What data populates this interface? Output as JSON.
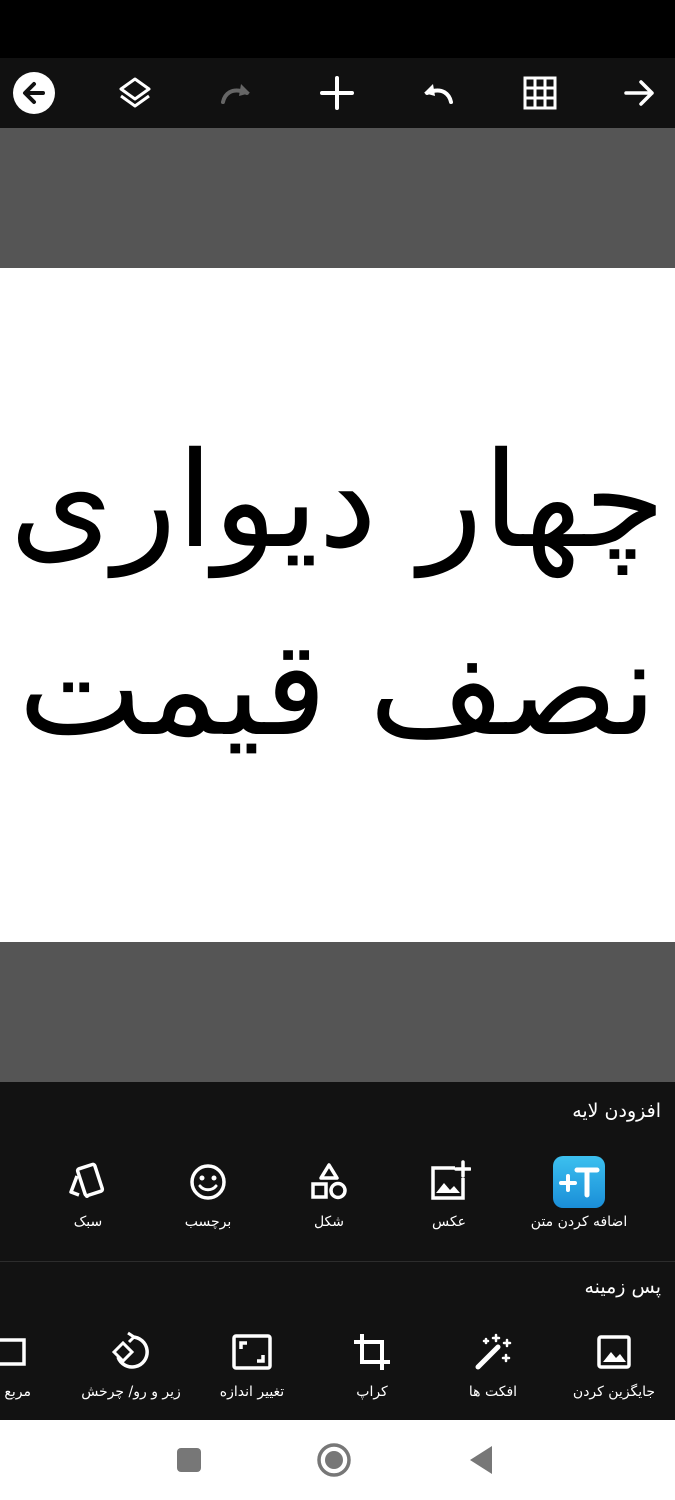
{
  "canvas": {
    "line1": "چهار دیواری",
    "line2": "نصف قیمت"
  },
  "toolbar": {
    "icons": [
      "back-circle-icon",
      "layers-icon",
      "redo-icon",
      "add-icon",
      "undo-icon",
      "grid-icon",
      "forward-arrow-icon"
    ]
  },
  "panel": {
    "add_layer_title": "افزودن لایه",
    "add_layer_items": [
      {
        "label": "اضافه کردن متن",
        "icon": "add-text-icon"
      },
      {
        "label": "عکس",
        "icon": "add-photo-icon"
      },
      {
        "label": "شکل",
        "icon": "shapes-icon"
      },
      {
        "label": "برچسب",
        "icon": "sticker-icon"
      },
      {
        "label": "سبک",
        "icon": "style-cards-icon"
      }
    ],
    "background_title": "پس زمینه",
    "background_items": [
      {
        "label": "جایگزین کردن",
        "icon": "replace-image-icon"
      },
      {
        "label": "افکت ها",
        "icon": "magic-wand-icon"
      },
      {
        "label": "کراپ",
        "icon": "crop-icon"
      },
      {
        "label": "تغییر اندازه",
        "icon": "resize-icon"
      },
      {
        "label": "زیر و رو/ چرخش",
        "icon": "flip-rotate-icon"
      },
      {
        "label": "مربع کا",
        "icon": "square-icon"
      }
    ]
  },
  "colors": {
    "toolbar_bg": "#111111",
    "canvas_surround": "#555555",
    "panel_bg": "#121212",
    "accent_text_tool": "#29a8e0"
  }
}
